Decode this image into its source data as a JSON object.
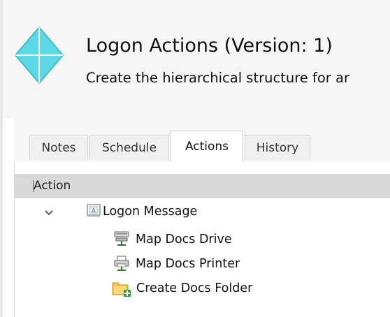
{
  "header": {
    "title": "Logon Actions (Version: 1)",
    "subtitle": "Create the hierarchical structure for ar"
  },
  "tabs": [
    {
      "label": "Notes",
      "active": false
    },
    {
      "label": "Schedule",
      "active": false
    },
    {
      "label": "Actions",
      "active": true
    },
    {
      "label": "History",
      "active": false
    }
  ],
  "grid": {
    "column_header": "Action"
  },
  "tree": {
    "root": {
      "label": "Logon Message",
      "icon": "message-icon",
      "expanded": true
    },
    "children": [
      {
        "label": "Map Docs Drive",
        "icon": "map-drive-icon"
      },
      {
        "label": "Map Docs Printer",
        "icon": "map-printer-icon"
      },
      {
        "label": "Create Docs Folder",
        "icon": "create-folder-icon"
      }
    ]
  },
  "colors": {
    "logo": "#5fd8e6",
    "header_bg": "#f6f6f6",
    "grid_header_bg": "#d9d9d9",
    "folder": "#f2c14e",
    "add_plus": "#2ea043"
  }
}
